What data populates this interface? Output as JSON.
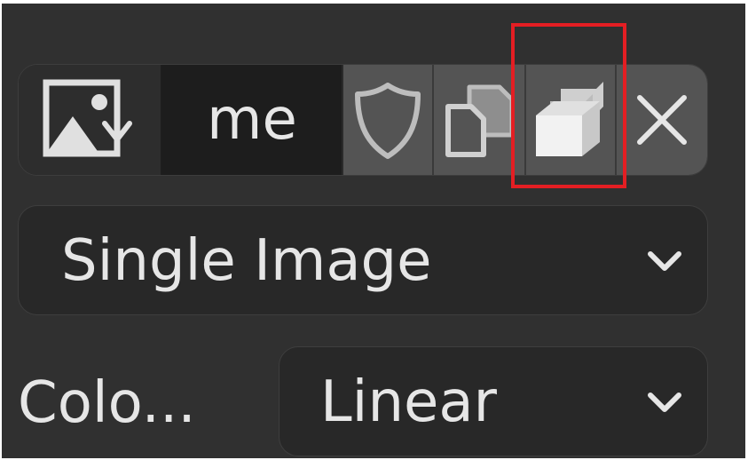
{
  "id_block": {
    "name_value": "me",
    "browse_icon": "image-browse-icon",
    "fake_user_icon": "shield-icon",
    "duplicate_icon": "duplicate-icon",
    "single_user_icon": "stacked-boxes-icon",
    "unlink_icon": "close-icon"
  },
  "source": {
    "selected": "Single Image"
  },
  "color_space": {
    "label": "Colo...",
    "selected": "Linear"
  },
  "colors": {
    "panel_bg": "#303030",
    "button_bg": "#545454",
    "field_bg": "#1d1d1d",
    "text": "#e6e6e6",
    "highlight": "#e41e23"
  }
}
